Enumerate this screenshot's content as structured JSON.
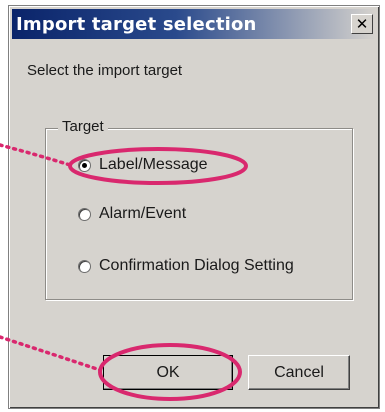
{
  "dialog": {
    "title": "Import target selection",
    "close_glyph": "✕",
    "prompt": "Select the import target",
    "group_label": "Target",
    "options": [
      {
        "label": "Label/Message",
        "checked": true
      },
      {
        "label": "Alarm/Event",
        "checked": false
      },
      {
        "label": "Confirmation Dialog Setting",
        "checked": false
      }
    ],
    "ok_label": "OK",
    "cancel_label": "Cancel"
  },
  "annotations": {
    "highlight_color": "#d9286e",
    "dot_color": "#d9286e"
  }
}
